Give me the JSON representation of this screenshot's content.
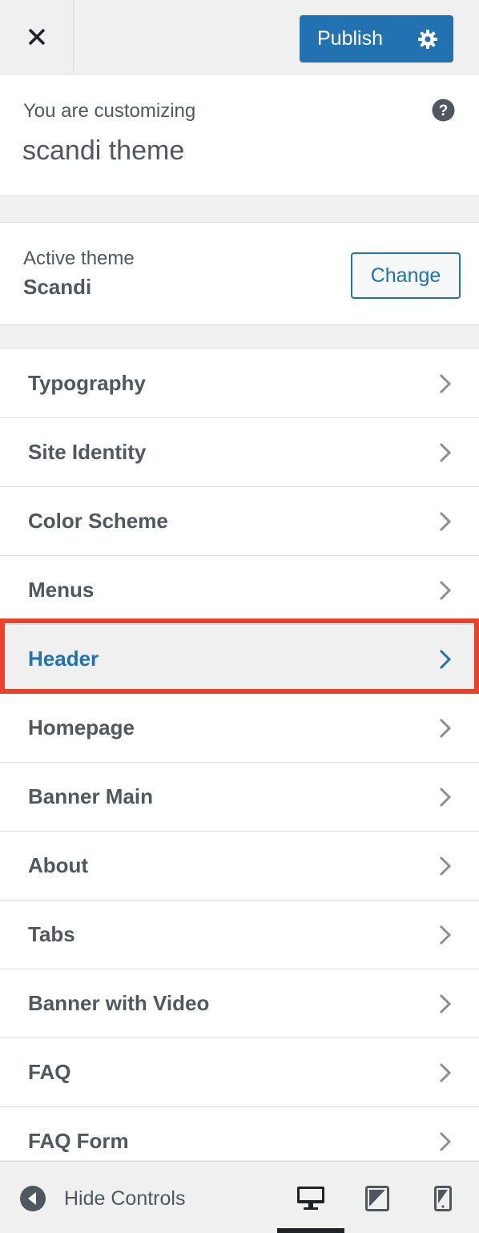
{
  "header": {
    "close_icon": "close-icon",
    "publish_label": "Publish",
    "settings_icon": "gear-icon"
  },
  "info": {
    "customizing_label": "You are customizing",
    "site_name": "scandi theme",
    "help_icon": "help-icon"
  },
  "theme": {
    "label": "Active theme",
    "name": "Scandi",
    "change_label": "Change"
  },
  "sections": [
    {
      "label": "Typography"
    },
    {
      "label": "Site Identity"
    },
    {
      "label": "Color Scheme"
    },
    {
      "label": "Menus"
    },
    {
      "label": "Header",
      "active": true
    },
    {
      "label": "Homepage"
    },
    {
      "label": "Banner Main"
    },
    {
      "label": "About"
    },
    {
      "label": "Tabs"
    },
    {
      "label": "Banner with Video"
    },
    {
      "label": "FAQ"
    },
    {
      "label": "FAQ Form"
    }
  ],
  "footer": {
    "hide_controls_label": "Hide Controls",
    "devices": [
      "desktop-icon",
      "tablet-icon",
      "mobile-icon"
    ],
    "active_device": "desktop"
  },
  "colors": {
    "accent": "#2271b1",
    "highlight": "#e8432a",
    "text": "#50575e"
  }
}
